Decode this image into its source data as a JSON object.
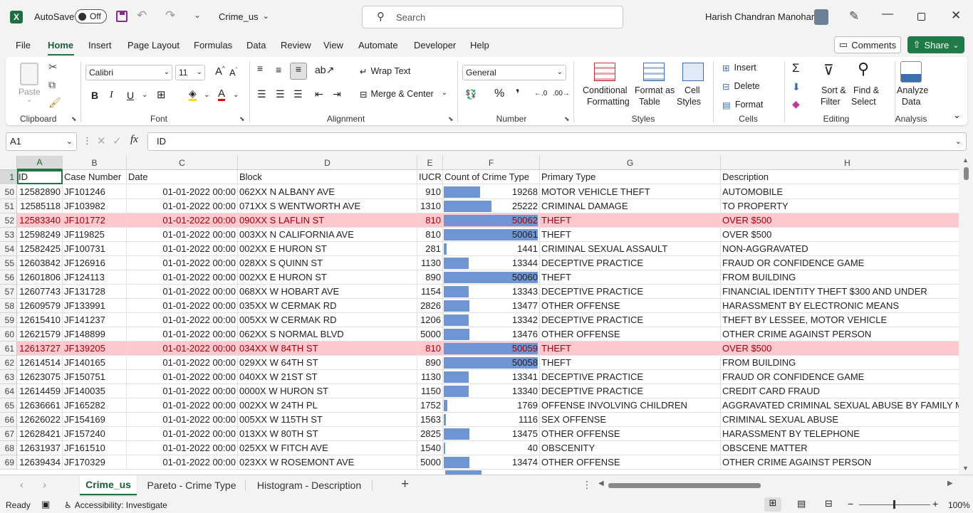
{
  "titlebar": {
    "autosave_label": "AutoSave",
    "autosave_state": "Off",
    "filename": "Crime_us",
    "search_placeholder": "Search",
    "user_name": "Harish Chandran Manohar"
  },
  "menu": {
    "tabs": [
      "File",
      "Home",
      "Insert",
      "Page Layout",
      "Formulas",
      "Data",
      "Review",
      "View",
      "Automate",
      "Developer",
      "Help"
    ],
    "active": "Home",
    "comments_label": "Comments",
    "share_label": "Share"
  },
  "ribbon": {
    "clipboard": {
      "paste": "Paste",
      "label": "Clipboard"
    },
    "font": {
      "name": "Calibri",
      "size": "11",
      "label": "Font"
    },
    "alignment": {
      "wrap": "Wrap Text",
      "merge": "Merge & Center",
      "label": "Alignment"
    },
    "number": {
      "format": "General",
      "label": "Number"
    },
    "styles": {
      "conditional": "Conditional",
      "conditional2": "Formatting",
      "format_as": "Format as",
      "format_as2": "Table",
      "cell": "Cell",
      "cell2": "Styles",
      "label": "Styles"
    },
    "cells": {
      "insert": "Insert",
      "delete": "Delete",
      "format": "Format",
      "label": "Cells"
    },
    "editing": {
      "sort": "Sort &",
      "sort2": "Filter",
      "find": "Find &",
      "find2": "Select",
      "label": "Editing"
    },
    "analysis": {
      "analyze": "Analyze",
      "analyze2": "Data",
      "label": "Analysis"
    }
  },
  "formula_bar": {
    "name_box": "A1",
    "fx": "fx",
    "content": "ID"
  },
  "columns": [
    "A",
    "B",
    "C",
    "D",
    "E",
    "F",
    "G",
    "H"
  ],
  "header_row": {
    "num": "1",
    "cells": [
      "ID",
      "Case Number",
      "Date",
      "Block",
      "IUCR",
      "Count of Crime Type",
      "Primary Type",
      "Description"
    ]
  },
  "bar_max": 50062,
  "rows": [
    {
      "num": "50",
      "id": "12582890",
      "case": "JF101246",
      "date": "01-01-2022 00:00",
      "block": "062XX N ALBANY AVE",
      "iucr": "910",
      "count": 19268,
      "count_text": "19268",
      "ptype": "MOTOR VEHICLE THEFT",
      "desc": "AUTOMOBILE",
      "hl": false
    },
    {
      "num": "51",
      "id": "12585118",
      "case": "JF103982",
      "date": "01-01-2022 00:00",
      "block": "071XX S WENTWORTH AVE",
      "iucr": "1310",
      "count": 25222,
      "count_text": "25222",
      "ptype": "CRIMINAL DAMAGE",
      "desc": "TO PROPERTY",
      "hl": false
    },
    {
      "num": "52",
      "id": "12583340",
      "case": "JF101772",
      "date": "01-01-2022 00:00",
      "block": "090XX S LAFLIN ST",
      "iucr": "810",
      "count": 50062,
      "count_text": "50062",
      "ptype": "THEFT",
      "desc": "OVER $500",
      "hl": true
    },
    {
      "num": "53",
      "id": "12598249",
      "case": "JF119825",
      "date": "01-01-2022 00:00",
      "block": "003XX N CALIFORNIA AVE",
      "iucr": "810",
      "count": 50061,
      "count_text": "50061",
      "ptype": "THEFT",
      "desc": "OVER $500",
      "hl": false
    },
    {
      "num": "54",
      "id": "12582425",
      "case": "JF100731",
      "date": "01-01-2022 00:00",
      "block": "002XX E HURON ST",
      "iucr": "281",
      "count": 1441,
      "count_text": "1441",
      "ptype": "CRIMINAL SEXUAL ASSAULT",
      "desc": "NON-AGGRAVATED",
      "hl": false
    },
    {
      "num": "55",
      "id": "12603842",
      "case": "JF126916",
      "date": "01-01-2022 00:00",
      "block": "028XX S QUINN ST",
      "iucr": "1130",
      "count": 13344,
      "count_text": "13344",
      "ptype": "DECEPTIVE PRACTICE",
      "desc": "FRAUD OR CONFIDENCE GAME",
      "hl": false
    },
    {
      "num": "56",
      "id": "12601806",
      "case": "JF124113",
      "date": "01-01-2022 00:00",
      "block": "002XX E HURON ST",
      "iucr": "890",
      "count": 50060,
      "count_text": "50060",
      "ptype": "THEFT",
      "desc": "FROM BUILDING",
      "hl": false
    },
    {
      "num": "57",
      "id": "12607743",
      "case": "JF131728",
      "date": "01-01-2022 00:00",
      "block": "068XX W HOBART AVE",
      "iucr": "1154",
      "count": 13343,
      "count_text": "13343",
      "ptype": "DECEPTIVE PRACTICE",
      "desc": "FINANCIAL IDENTITY THEFT $300 AND UNDER",
      "hl": false
    },
    {
      "num": "58",
      "id": "12609579",
      "case": "JF133991",
      "date": "01-01-2022 00:00",
      "block": "035XX W CERMAK RD",
      "iucr": "2826",
      "count": 13477,
      "count_text": "13477",
      "ptype": "OTHER OFFENSE",
      "desc": "HARASSMENT BY ELECTRONIC MEANS",
      "hl": false
    },
    {
      "num": "59",
      "id": "12615410",
      "case": "JF141237",
      "date": "01-01-2022 00:00",
      "block": "005XX W CERMAK RD",
      "iucr": "1206",
      "count": 13342,
      "count_text": "13342",
      "ptype": "DECEPTIVE PRACTICE",
      "desc": "THEFT BY LESSEE, MOTOR VEHICLE",
      "hl": false
    },
    {
      "num": "60",
      "id": "12621579",
      "case": "JF148899",
      "date": "01-01-2022 00:00",
      "block": "062XX S NORMAL BLVD",
      "iucr": "5000",
      "count": 13476,
      "count_text": "13476",
      "ptype": "OTHER OFFENSE",
      "desc": "OTHER CRIME AGAINST PERSON",
      "hl": false
    },
    {
      "num": "61",
      "id": "12613727",
      "case": "JF139205",
      "date": "01-01-2022 00:00",
      "block": "034XX W 84TH ST",
      "iucr": "810",
      "count": 50059,
      "count_text": "50059",
      "ptype": "THEFT",
      "desc": "OVER $500",
      "hl": true
    },
    {
      "num": "62",
      "id": "12614514",
      "case": "JF140165",
      "date": "01-01-2022 00:00",
      "block": "029XX W 64TH ST",
      "iucr": "890",
      "count": 50058,
      "count_text": "50058",
      "ptype": "THEFT",
      "desc": "FROM BUILDING",
      "hl": false
    },
    {
      "num": "63",
      "id": "12623075",
      "case": "JF150751",
      "date": "01-01-2022 00:00",
      "block": "040XX W 21ST ST",
      "iucr": "1130",
      "count": 13341,
      "count_text": "13341",
      "ptype": "DECEPTIVE PRACTICE",
      "desc": "FRAUD OR CONFIDENCE GAME",
      "hl": false
    },
    {
      "num": "64",
      "id": "12614459",
      "case": "JF140035",
      "date": "01-01-2022 00:00",
      "block": "0000X W HURON ST",
      "iucr": "1150",
      "count": 13340,
      "count_text": "13340",
      "ptype": "DECEPTIVE PRACTICE",
      "desc": "CREDIT CARD FRAUD",
      "hl": false
    },
    {
      "num": "65",
      "id": "12636661",
      "case": "JF165282",
      "date": "01-01-2022 00:00",
      "block": "002XX W 24TH PL",
      "iucr": "1752",
      "count": 1769,
      "count_text": "1769",
      "ptype": "OFFENSE INVOLVING CHILDREN",
      "desc": "AGGRAVATED CRIMINAL SEXUAL ABUSE BY FAMILY ME",
      "hl": false
    },
    {
      "num": "66",
      "id": "12626022",
      "case": "JF154169",
      "date": "01-01-2022 00:00",
      "block": "005XX W 115TH ST",
      "iucr": "1563",
      "count": 1116,
      "count_text": "1116",
      "ptype": "SEX OFFENSE",
      "desc": "CRIMINAL SEXUAL ABUSE",
      "hl": false
    },
    {
      "num": "67",
      "id": "12628421",
      "case": "JF157240",
      "date": "01-01-2022 00:00",
      "block": "013XX W 80TH ST",
      "iucr": "2825",
      "count": 13475,
      "count_text": "13475",
      "ptype": "OTHER OFFENSE",
      "desc": "HARASSMENT BY TELEPHONE",
      "hl": false
    },
    {
      "num": "68",
      "id": "12631937",
      "case": "JF161510",
      "date": "01-01-2022 00:00",
      "block": "025XX W FITCH AVE",
      "iucr": "1540",
      "count": 40,
      "count_text": "40",
      "ptype": "OBSCENITY",
      "desc": "OBSCENE MATTER",
      "hl": false
    },
    {
      "num": "69",
      "id": "12639434",
      "case": "JF170329",
      "date": "01-01-2022 00:00",
      "block": "023XX W ROSEMONT AVE",
      "iucr": "5000",
      "count": 13474,
      "count_text": "13474",
      "ptype": "OTHER OFFENSE",
      "desc": "OTHER CRIME AGAINST PERSON",
      "hl": false
    }
  ],
  "sheets": [
    "Crime_us",
    "Pareto - Crime Type",
    "Histogram - Description"
  ],
  "active_sheet": "Crime_us",
  "status": {
    "ready": "Ready",
    "accessibility": "Accessibility: Investigate",
    "zoom": "100%"
  },
  "colors": {
    "accent": "#217346",
    "bar": "#6f95d2",
    "highlight_fill": "#ffc7ce",
    "highlight_text": "#9c0006"
  }
}
